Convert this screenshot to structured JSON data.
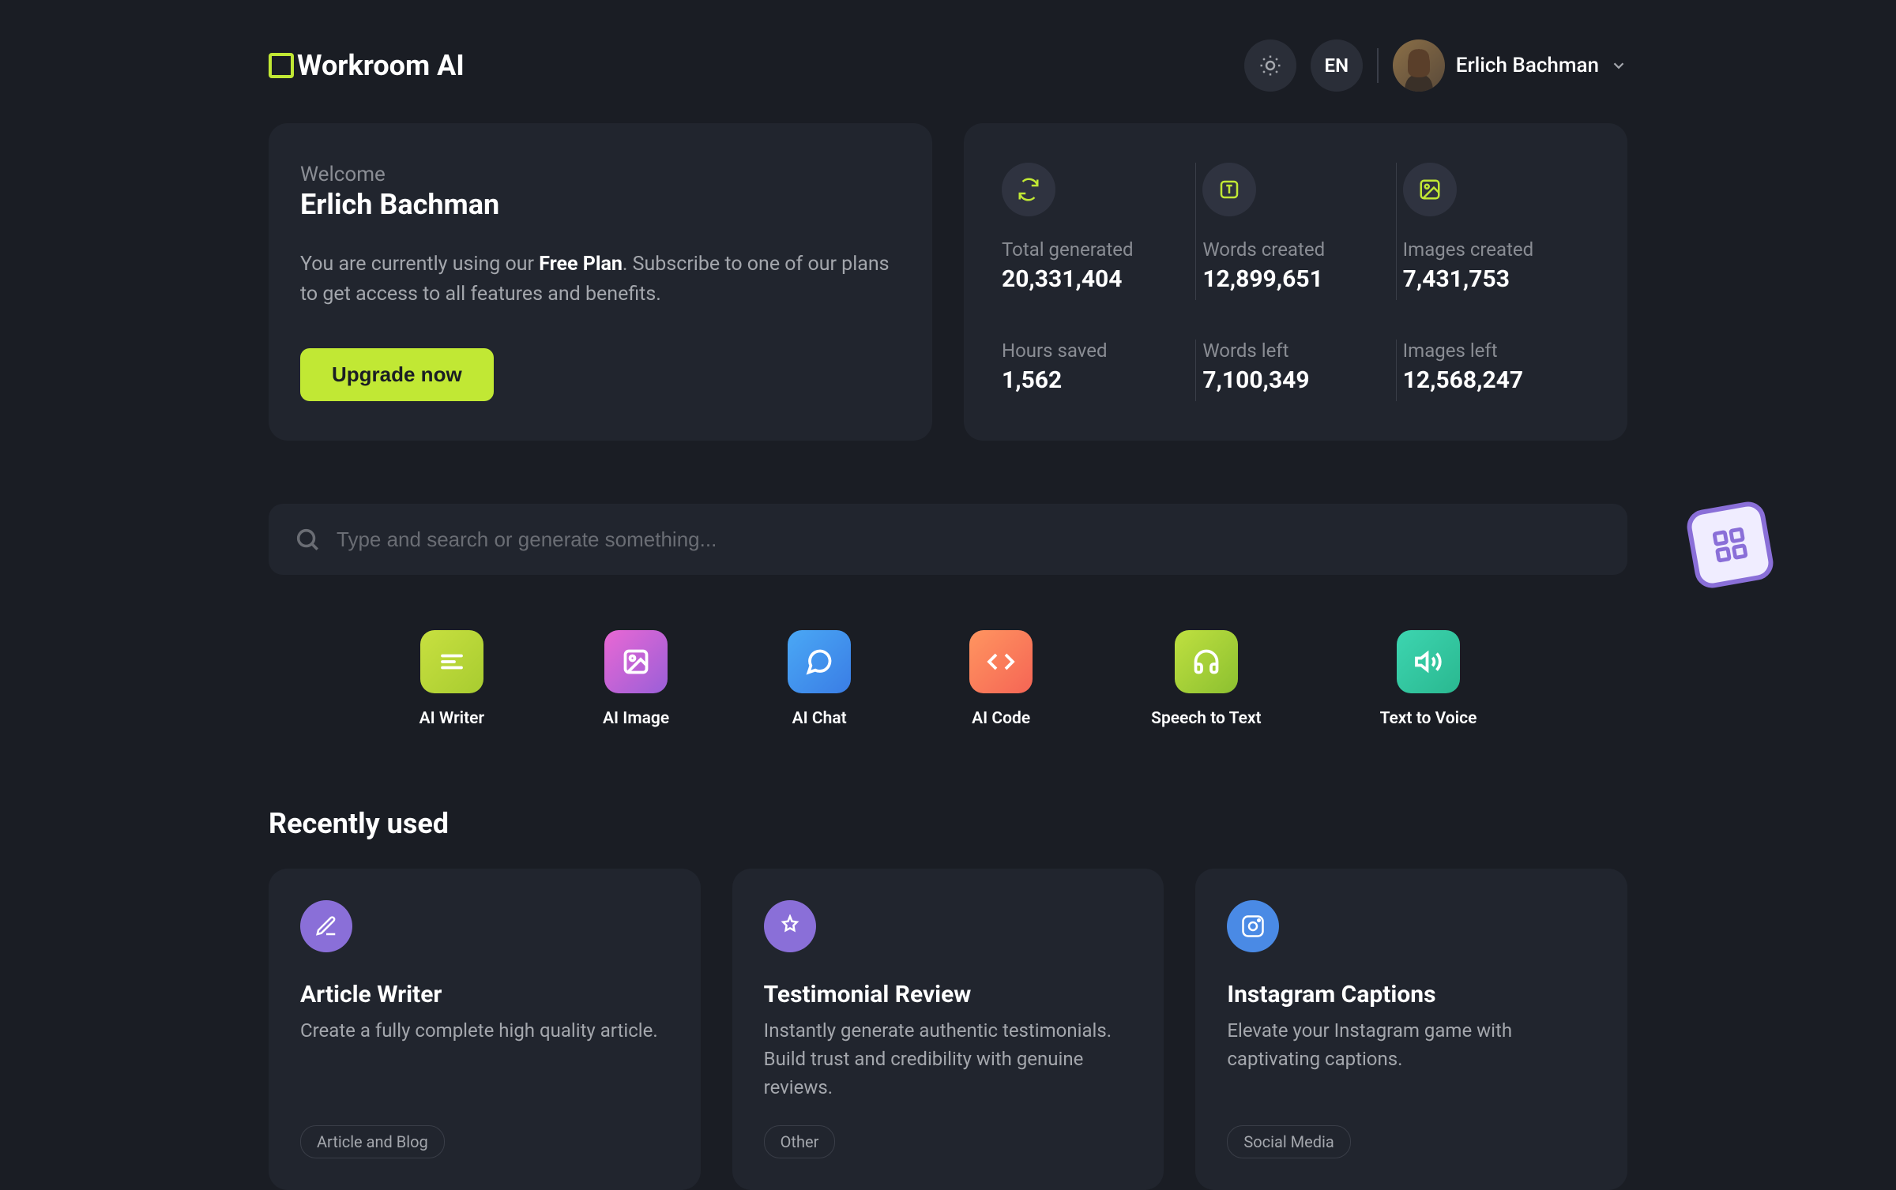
{
  "brand": "Workroom AI",
  "header": {
    "language": "EN",
    "user_name": "Erlich Bachman"
  },
  "welcome": {
    "label": "Welcome",
    "name": "Erlich Bachman",
    "plan_prefix": "You are currently using our ",
    "plan_name": "Free Plan",
    "plan_suffix": ". Subscribe to one of our plans to get access to all features and benefits.",
    "upgrade_label": "Upgrade now"
  },
  "stats": [
    {
      "label": "Total generated",
      "value": "20,331,404",
      "icon": "refresh"
    },
    {
      "label": "Words created",
      "value": "12,899,651",
      "icon": "text"
    },
    {
      "label": "Images created",
      "value": "7,431,753",
      "icon": "image"
    },
    {
      "label": "Hours saved",
      "value": "1,562",
      "icon": "none"
    },
    {
      "label": "Words left",
      "value": "7,100,349",
      "icon": "none"
    },
    {
      "label": "Images left",
      "value": "12,568,247",
      "icon": "none"
    }
  ],
  "search": {
    "placeholder": "Type and search or generate something..."
  },
  "tools": [
    {
      "label": "AI Writer",
      "class": "tool-writer",
      "icon": "lines"
    },
    {
      "label": "AI Image",
      "class": "tool-image",
      "icon": "image"
    },
    {
      "label": "AI Chat",
      "class": "tool-chat",
      "icon": "chat"
    },
    {
      "label": "AI Code",
      "class": "tool-code",
      "icon": "code"
    },
    {
      "label": "Speech to Text",
      "class": "tool-speech",
      "icon": "headphones"
    },
    {
      "label": "Text to Voice",
      "class": "tool-voice",
      "icon": "volume"
    }
  ],
  "recent_title": "Recently used",
  "recent": [
    {
      "title": "Article Writer",
      "desc": "Create a fully complete high quality article.",
      "tag": "Article and Blog",
      "icon": "pencil",
      "icon_class": "recent-icon-purple"
    },
    {
      "title": "Testimonial Review",
      "desc": "Instantly generate authentic testimonials. Build trust and credibility with genuine reviews.",
      "tag": "Other",
      "icon": "stars",
      "icon_class": "recent-icon-purple"
    },
    {
      "title": "Instagram Captions",
      "desc": "Elevate your Instagram game with captivating captions.",
      "tag": "Social Media",
      "icon": "instagram",
      "icon_class": "recent-icon-blue"
    }
  ]
}
